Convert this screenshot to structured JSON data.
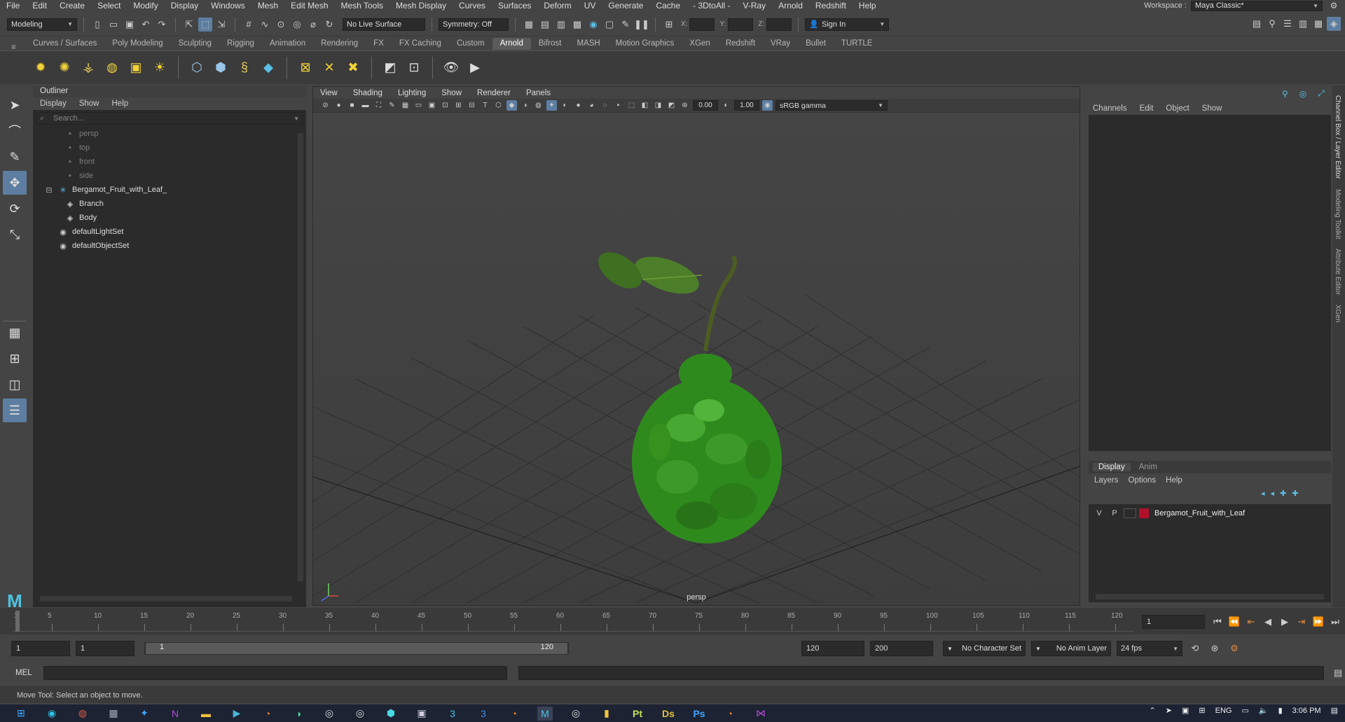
{
  "menubar": {
    "items": [
      "File",
      "Edit",
      "Create",
      "Select",
      "Modify",
      "Display",
      "Windows",
      "Mesh",
      "Edit Mesh",
      "Mesh Tools",
      "Mesh Display",
      "Curves",
      "Surfaces",
      "Deform",
      "UV",
      "Generate",
      "Cache",
      "- 3DtoAll -",
      "V-Ray",
      "Arnold",
      "Redshift",
      "Help"
    ],
    "workspace_label": "Workspace :",
    "workspace_value": "Maya Classic*"
  },
  "statusline": {
    "mode": "Modeling",
    "live_surface": "No Live Surface",
    "symmetry": "Symmetry: Off",
    "x_label": "X:",
    "y_label": "Y:",
    "z_label": "Z:",
    "sign_in": "Sign In"
  },
  "shelf": {
    "tabs": [
      "Curves / Surfaces",
      "Poly Modeling",
      "Sculpting",
      "Rigging",
      "Animation",
      "Rendering",
      "FX",
      "FX Caching",
      "Custom",
      "Arnold",
      "Bifrost",
      "MASH",
      "Motion Graphics",
      "XGen",
      "Redshift",
      "VRay",
      "Bullet",
      "TURTLE"
    ],
    "active_tab": "Arnold"
  },
  "outliner": {
    "title": "Outliner",
    "menu": [
      "Display",
      "Show",
      "Help"
    ],
    "search_placeholder": "Search...",
    "items": [
      {
        "label": "persp",
        "icon": "camera-icon",
        "indent": 2,
        "dim": true
      },
      {
        "label": "top",
        "icon": "camera-icon",
        "indent": 2,
        "dim": true
      },
      {
        "label": "front",
        "icon": "camera-icon",
        "indent": 2,
        "dim": true
      },
      {
        "label": "side",
        "icon": "camera-icon",
        "indent": 2,
        "dim": true
      },
      {
        "label": "Bergamot_Fruit_with_Leaf_",
        "icon": "group-icon",
        "indent": 1,
        "dim": false,
        "expand": "−"
      },
      {
        "label": "Branch",
        "icon": "mesh-icon",
        "indent": 2,
        "dim": false
      },
      {
        "label": "Body",
        "icon": "mesh-icon",
        "indent": 2,
        "dim": false
      },
      {
        "label": "defaultLightSet",
        "icon": "set-icon",
        "indent": 1,
        "dim": false
      },
      {
        "label": "defaultObjectSet",
        "icon": "set-icon",
        "indent": 1,
        "dim": false
      }
    ]
  },
  "viewport": {
    "menu": [
      "View",
      "Shading",
      "Lighting",
      "Show",
      "Renderer",
      "Panels"
    ],
    "exposure": "0.00",
    "gamma": "1.00",
    "color_space": "sRGB gamma",
    "camera_label": "persp"
  },
  "channelbox": {
    "menu": [
      "Channels",
      "Edit",
      "Object",
      "Show"
    ]
  },
  "layereditor": {
    "tabs": [
      "Display",
      "Anim"
    ],
    "active_tab": "Display",
    "menu": [
      "Layers",
      "Options",
      "Help"
    ],
    "layer": {
      "v": "V",
      "p": "P",
      "name": "Bergamot_Fruit_with_Leaf",
      "color": "#b0102a"
    }
  },
  "side_tabs": [
    "Channel Box / Layer Editor",
    "Modeling Toolkit",
    "Attribute Editor",
    "XGen"
  ],
  "timeline": {
    "ticks": [
      "1",
      "5",
      "10",
      "15",
      "20",
      "25",
      "30",
      "35",
      "40",
      "45",
      "50",
      "55",
      "60",
      "65",
      "70",
      "75",
      "80",
      "85",
      "90",
      "95",
      "100",
      "105",
      "110",
      "115",
      "120"
    ],
    "current_frame": "1"
  },
  "range": {
    "start": "1",
    "playback_start": "1",
    "slider_start": "1",
    "slider_end": "120",
    "playback_end": "120",
    "end": "200",
    "character_set": "No Character Set",
    "anim_layer": "No Anim Layer",
    "fps": "24 fps"
  },
  "cmdline": {
    "label": "MEL"
  },
  "helpline": {
    "text": "Move Tool: Select an object to move."
  },
  "taskbar": {
    "lang": "ENG",
    "time": "3:06 PM"
  },
  "colors": {
    "accent": "#5d7ea1",
    "fruit": "#2f8a1e",
    "layer_swatch": "#b0102a"
  }
}
